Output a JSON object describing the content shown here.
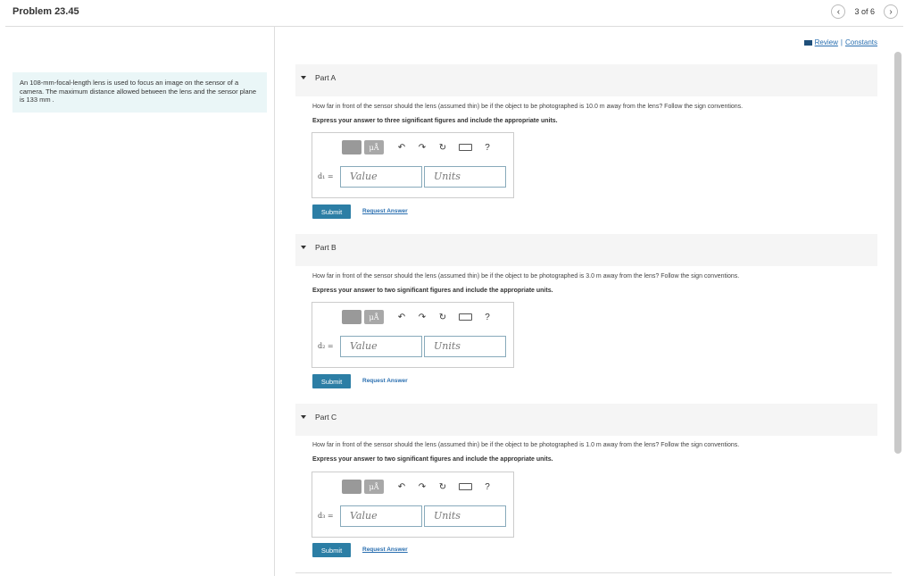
{
  "header": {
    "title": "Problem 23.45",
    "pager_text": "3 of 6",
    "prev_symbol": "‹",
    "next_symbol": "›"
  },
  "links": {
    "review": "Review",
    "separator": "|",
    "constants": "Constants"
  },
  "problem_text": "An 108-mm-focal-length lens is used to focus an image on the sensor of a camera. The maximum distance allowed between the lens and the sensor plane is 133  mm .",
  "toolbar": {
    "mu_label": "μÅ",
    "undo": "↶",
    "redo": "↷",
    "reset": "↻",
    "help": "?"
  },
  "parts": [
    {
      "label": "Part A",
      "question": "How far in front of the sensor should the lens (assumed thin) be if the object to be photographed is 10.0 m away from the lens? Follow the sign conventions.",
      "instruction": "Express your answer to three significant figures and include the appropriate units.",
      "var_label": "d₁ =",
      "value_placeholder": "Value",
      "units_placeholder": "Units",
      "submit": "Submit",
      "request": "Request Answer"
    },
    {
      "label": "Part B",
      "question": "How far in front of the sensor should the lens (assumed thin) be if the object to be photographed is 3.0 m away from the lens? Follow the sign conventions.",
      "instruction": "Express your answer to two significant figures and include the appropriate units.",
      "var_label": "d₂ =",
      "value_placeholder": "Value",
      "units_placeholder": "Units",
      "submit": "Submit",
      "request": "Request Answer"
    },
    {
      "label": "Part C",
      "question": "How far in front of the sensor should the lens (assumed thin) be if the object to be photographed is 1.0 m away from the lens? Follow the sign conventions.",
      "instruction": "Express your answer to two significant figures and include the appropriate units.",
      "var_label": "d₃ =",
      "value_placeholder": "Value",
      "units_placeholder": "Units",
      "submit": "Submit",
      "request": "Request Answer"
    }
  ]
}
